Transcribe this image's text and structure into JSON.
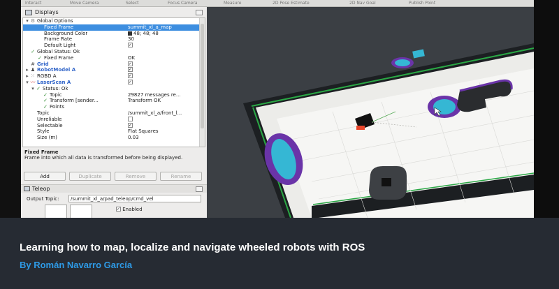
{
  "toolbar": {
    "items": [
      "Interact",
      "Move Camera",
      "Select",
      "Focus Camera",
      "Measure",
      "2D Pose Estimate",
      "2D Nav Goal",
      "Publish Point"
    ]
  },
  "displays_panel": {
    "title": "Displays",
    "rows": [
      {
        "name": "Global Options",
        "value": "",
        "icon": "gear-icon"
      },
      {
        "name": "Fixed Frame",
        "value": "summit_xl_a_map",
        "selected": true
      },
      {
        "name": "Background Color",
        "value": "48; 48; 48",
        "swatch": "#303030"
      },
      {
        "name": "Frame Rate",
        "value": "30"
      },
      {
        "name": "Default Light",
        "value": "",
        "check": true
      },
      {
        "name": "Global Status: Ok",
        "value": "",
        "icon": "status-ok-icon"
      },
      {
        "name": "Fixed Frame",
        "value": "OK",
        "icon": "status-ok-icon"
      },
      {
        "name": "Grid",
        "value": "",
        "check": true,
        "icon": "grid-icon",
        "display": true
      },
      {
        "name": "RobotModel A",
        "value": "",
        "check": true,
        "icon": "robot-model-icon",
        "display": true
      },
      {
        "name": "RGBD A",
        "value": "",
        "check": true,
        "icon": "pointcloud-icon"
      },
      {
        "name": "LaserScan A",
        "value": "",
        "check": true,
        "icon": "laserscan-icon",
        "display": true
      },
      {
        "name": "Status: Ok",
        "value": "",
        "icon": "status-ok-icon"
      },
      {
        "name": "Topic",
        "value": "29827 messages re...",
        "icon": "status-ok-icon"
      },
      {
        "name": "Transform [sender...",
        "value": "Transform OK",
        "icon": "status-ok-icon"
      },
      {
        "name": "Points",
        "value": "",
        "icon": "status-ok-icon"
      },
      {
        "name": "Topic",
        "value": "/summit_xl_a/front_l..."
      },
      {
        "name": "Unreliable",
        "value": "",
        "check": false
      },
      {
        "name": "Selectable",
        "value": "",
        "check": true
      },
      {
        "name": "Style",
        "value": "Flat Squares"
      },
      {
        "name": "Size (m)",
        "value": "0.03"
      }
    ],
    "description_title": "Fixed Frame",
    "description_text": "Frame into which all data is transformed before being displayed.",
    "buttons": {
      "add": "Add",
      "duplicate": "Duplicate",
      "remove": "Remove",
      "rename": "Rename"
    }
  },
  "teleop_panel": {
    "title": "Teleop",
    "output_topic_label": "Output Topic:",
    "output_topic_value": "/summit_xl_a/pad_teleop/cmd_vel",
    "enabled_label": "Enabled"
  },
  "caption": {
    "title": "Learning how to map, localize and navigate wheeled robots with ROS",
    "author": "By Román Navarro García"
  },
  "colors": {
    "selection": "#3d8ee0",
    "floor": "#eeeeec",
    "wall": "#1c1f22",
    "path_green": "#2aa845",
    "obstacle_cyan": "#35b7d4",
    "obstacle_purple": "#6a34a8",
    "caption_bg": "#262b33",
    "author": "#2e9ae6"
  }
}
